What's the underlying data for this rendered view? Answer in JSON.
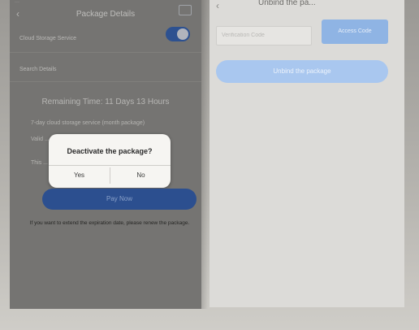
{
  "left_screen": {
    "status": "···",
    "nav": {
      "back_icon": "back-arrow-icon",
      "title": "Package Details",
      "right_icon": "screen-icon"
    },
    "cloud_storage_label": "Cloud Storage Service",
    "cloud_storage_enabled": true,
    "search_label": "Search Details",
    "remaining_label": "Remaining Time:",
    "remaining_value": "11 Days 13 Hours",
    "detail_line_1": "7-day cloud storage service (month package)",
    "detail_line_2": "Valid ... 2020-01-07",
    "detail_line_3": "This ... ithout",
    "dialog": {
      "title": "Deactivate the package?",
      "yes_label": "Yes",
      "no_label": "No"
    },
    "pay_button_label": "Pay Now",
    "hint_text": "If you want to extend the expiration date, please renew the package."
  },
  "right_screen": {
    "nav": {
      "back_icon": "back-arrow-icon",
      "title": "Unbind the pa..."
    },
    "code_input_placeholder": "Verification Code",
    "get_code_button_label": "Access Code",
    "unbind_button_label": "Unbind the package"
  },
  "colors": {
    "toggle_on": "#2f5fb3",
    "pay_button": "#2c4f8f",
    "unbind_button": "#a9c7ef",
    "get_code_button": "#8fb4e4"
  }
}
